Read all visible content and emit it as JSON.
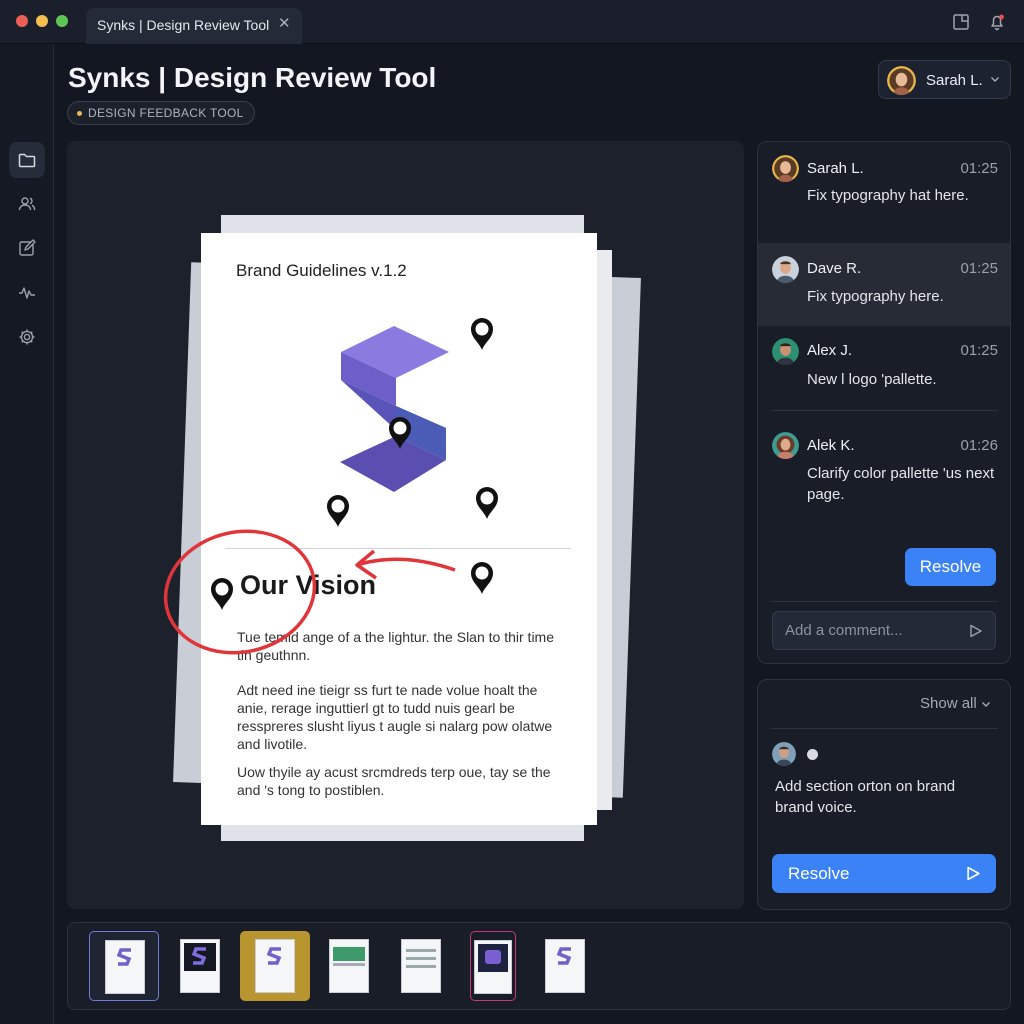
{
  "window": {
    "tab_title": "Synks | Design Review Tool",
    "tab_close": "✕"
  },
  "header": {
    "title": "Synks | Design Review Tool",
    "badge": "DESIGN FEEDBACK TOOL",
    "user_name": "Sarah L."
  },
  "sidebar": {
    "items": [
      {
        "icon": "folder-icon",
        "label": "Files"
      },
      {
        "icon": "users-icon",
        "label": "Team"
      },
      {
        "icon": "edit-icon",
        "label": "Edit"
      },
      {
        "icon": "activity-icon",
        "label": "Activity"
      },
      {
        "icon": "gear-icon",
        "label": "Settings"
      }
    ]
  },
  "document": {
    "heading": "Brand Guidelines v.1.2",
    "section_title": "Our Vision",
    "paragraphs": [
      "Tue temid ange of a the lightur. the Slan to thir time tin geuthnn.",
      "Adt need ine tieigr ss furt te nade volue hoalt the anie, rerage inguttierl gt to tudd nuis gearl be resspreres slusht liyus t augle si nalarg pow olatwe and livotile.",
      "Uow thyile ay acust srcmdreds terp oue, tay se the and 's tong to postiblen."
    ]
  },
  "comments": [
    {
      "author": "Sarah L.",
      "time": "01:25",
      "text": "Fix typography hat here."
    },
    {
      "author": "Dave R.",
      "time": "01:25",
      "text": "Fix typography here."
    },
    {
      "author": "Alex J.",
      "time": "01:25",
      "text": "New l logo 'pallette."
    },
    {
      "author": "Alek K.",
      "time": "01:26",
      "text": "Clarify color pallette 'us next page."
    }
  ],
  "resolve_label": "Resolve",
  "comment_input": {
    "placeholder": "Add a comment...",
    "value": ""
  },
  "panel2": {
    "show_all": "Show all",
    "text": "Add section orton on brand brand voice.",
    "resolve_label": "Resolve"
  },
  "thumbnails": [
    {
      "name": "thumb-1",
      "selected": true
    },
    {
      "name": "thumb-2"
    },
    {
      "name": "thumb-3",
      "highlight_color": "#b8952e"
    },
    {
      "name": "thumb-4"
    },
    {
      "name": "thumb-5"
    },
    {
      "name": "thumb-6",
      "highlight_color": "#c23a7a"
    },
    {
      "name": "thumb-7"
    }
  ],
  "colors": {
    "accent": "#3b82f6",
    "annotation_red": "#e0353a",
    "logo_purple": "#6e5fc4",
    "background": "#121722"
  }
}
